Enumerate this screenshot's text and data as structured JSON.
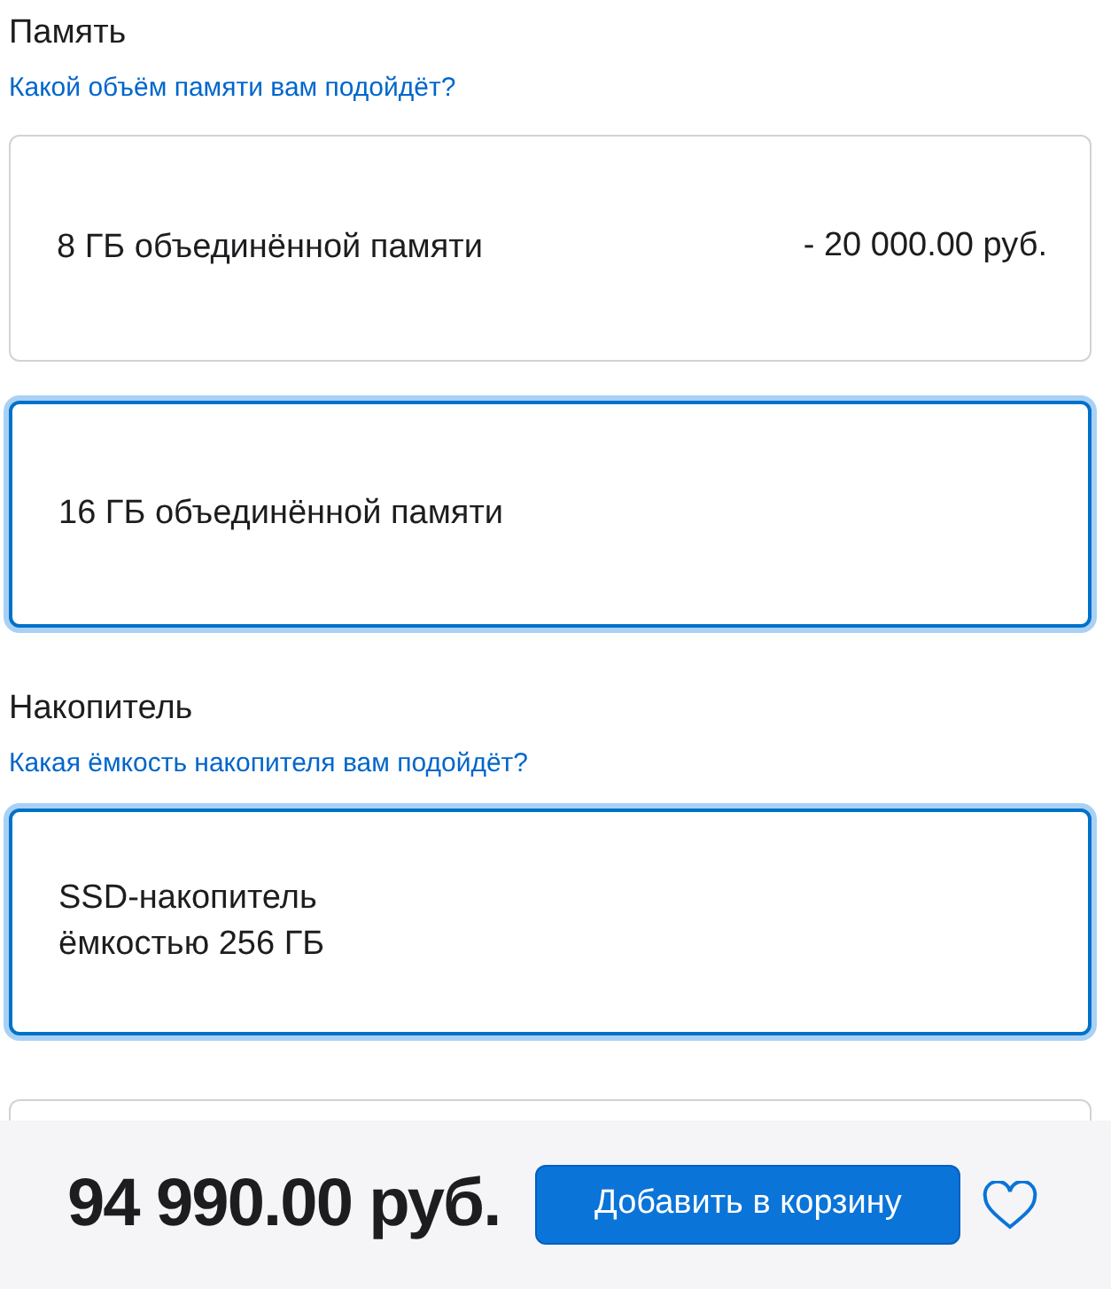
{
  "sections": [
    {
      "title": "Память",
      "help_link": "Какой объём памяти вам подойдёт?",
      "options": [
        {
          "label": "8 ГБ объединённой памяти",
          "price": "- 20 000.00 руб.",
          "selected": false
        },
        {
          "label": "16 ГБ объединённой памяти",
          "selected": true
        }
      ]
    },
    {
      "title": "Накопитель",
      "help_link": "Какая ёмкость накопителя вам подойдёт?",
      "options": [
        {
          "label": "SSD-накопитель\nёмкостью 256 ГБ",
          "selected": true
        }
      ]
    }
  ],
  "footer": {
    "total": "94 990.00 руб.",
    "add_button": "Добавить в корзину"
  }
}
